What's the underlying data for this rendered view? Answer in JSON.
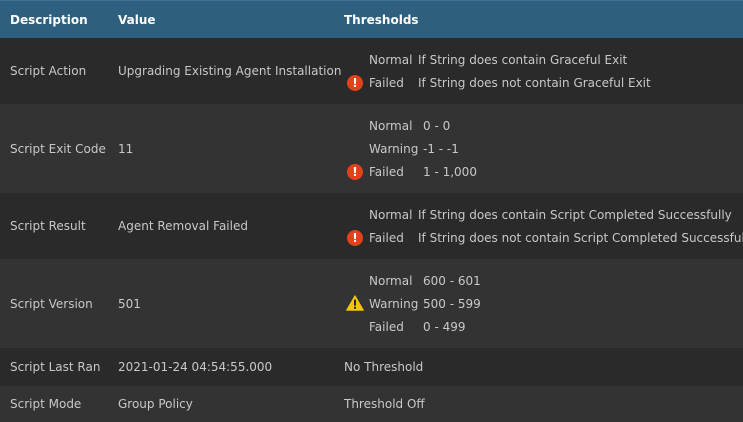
{
  "header": {
    "description": "Description",
    "value": "Value",
    "thresholds": "Thresholds"
  },
  "rows": [
    {
      "description": "Script Action",
      "value": "Upgrading Existing Agent Installation",
      "thresholds": [
        {
          "label": "Normal",
          "value": "If String does contain Graceful Exit"
        },
        {
          "label": "Failed",
          "value": "If String does not contain Graceful Exit"
        }
      ],
      "status_icon": "error-icon"
    },
    {
      "description": "Script Exit Code",
      "value": "11",
      "thresholds": [
        {
          "label": "Normal",
          "value": "0 - 0"
        },
        {
          "label": "Warning",
          "value": "-1 - -1"
        },
        {
          "label": "Failed",
          "value": "1 - 1,000"
        }
      ],
      "status_icon": "error-icon"
    },
    {
      "description": "Script Result",
      "value": "Agent Removal Failed",
      "thresholds": [
        {
          "label": "Normal",
          "value": "If String does contain Script Completed Successfully"
        },
        {
          "label": "Failed",
          "value": "If String does not contain Script Completed Successfully"
        }
      ],
      "status_icon": "error-icon"
    },
    {
      "description": "Script Version",
      "value": "501",
      "thresholds": [
        {
          "label": "Normal",
          "value": "600 - 601"
        },
        {
          "label": "Warning",
          "value": "500 - 599"
        },
        {
          "label": "Failed",
          "value": "0 - 499"
        }
      ],
      "status_icon": "warning-icon"
    },
    {
      "description": "Script Last Ran",
      "value": "2021-01-24 04:54:55.000",
      "threshold_text": "No Threshold"
    },
    {
      "description": "Script Mode",
      "value": "Group Policy",
      "threshold_text": "Threshold Off"
    }
  ],
  "colors": {
    "header_bg": "#2e5f7e",
    "error": "#e0421c",
    "warning": "#f2c40d"
  }
}
